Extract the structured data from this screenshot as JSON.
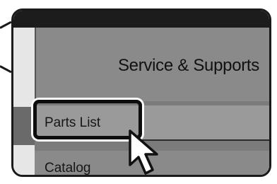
{
  "panel": {
    "title": "Service & Supports"
  },
  "menu": {
    "items": [
      {
        "label": "Parts List",
        "selected": true
      },
      {
        "label": "Catalog",
        "selected": false
      }
    ]
  },
  "icons": {
    "cursor": "arrow-pointer-icon"
  },
  "colors": {
    "topbar": "#1c1c1c",
    "panel": "#7b7b7b",
    "highlight_border": "#0d0d0d"
  }
}
